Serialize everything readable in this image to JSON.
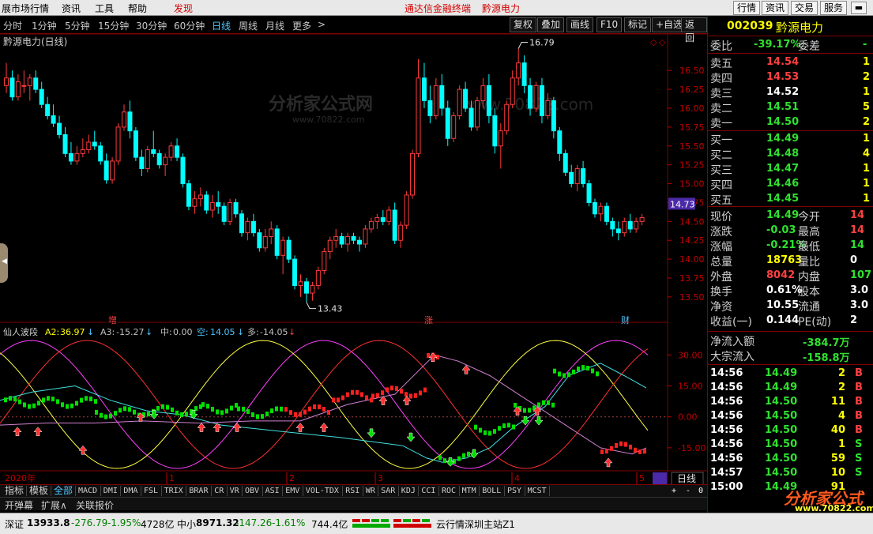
{
  "menu": {
    "items": [
      "展市场行情",
      "资讯",
      "工具",
      "帮助"
    ],
    "discover": "发现",
    "center_title": "通达信金融终端",
    "center_stock": "黔源电力",
    "right_buttons": [
      "行情",
      "资讯",
      "交易",
      "服务"
    ]
  },
  "periods": {
    "items": [
      "分时",
      "1分钟",
      "5分钟",
      "15分钟",
      "30分钟",
      "60分钟",
      "日线",
      "周线",
      "月线",
      "更多"
    ],
    "active": "日线",
    "more_arrow": ">",
    "tools": [
      "复权",
      "叠加",
      "画线",
      "F10",
      "标记",
      "+自选",
      "返回"
    ]
  },
  "main_chart": {
    "title": "黔源电力(日线)",
    "high_label": "16.79",
    "low_label": "13.43",
    "price_ticks": [
      "16.50",
      "16.25",
      "16.00",
      "15.75",
      "15.50",
      "15.25",
      "15.00",
      "14.75",
      "14.50",
      "14.25",
      "14.00",
      "13.75",
      "13.50"
    ],
    "current_price_tag": "14.73",
    "event_marks": [
      "增",
      "涨",
      "财"
    ],
    "watermark_1": "分析家公式网",
    "watermark_2": "www.70822.com",
    "watermark_3": "www.70822.com"
  },
  "indicator": {
    "name": "仙人波段",
    "a2_label": "A2:",
    "a2_value": "36.97",
    "a3_label": "A3:",
    "a3_value": "-15.27",
    "mid_label": "中:",
    "mid_value": "0.00",
    "empty_label": "空:",
    "empty_value": "14.05",
    "many_label": "多:",
    "many_value": "-14.05",
    "ticks": [
      "30.00",
      "15.00",
      "0.00",
      "-15.00"
    ]
  },
  "time_axis": {
    "labels": [
      "2020年",
      "1",
      "2",
      "3",
      "4",
      "5"
    ],
    "period_button": "日线"
  },
  "indicator_tabs": {
    "items": [
      "指标",
      "模板",
      "全部",
      "MACD",
      "DMI",
      "DMA",
      "FSL",
      "TRIX",
      "BRAR",
      "CR",
      "VR",
      "OBV",
      "ASI",
      "EMV",
      "VOL-TDX",
      "RSI",
      "WR",
      "SAR",
      "KDJ",
      "CCI",
      "ROC",
      "MTM",
      "BOLL",
      "PSY",
      "MCST"
    ],
    "active": "全部",
    "controls": [
      "+",
      "-",
      "0"
    ]
  },
  "bottom_links": [
    "开弹幕",
    "扩展∧",
    "关联报价"
  ],
  "quote": {
    "code": "002039",
    "name": "黔源电力",
    "weibi_label": "委比",
    "weibi": "-39.17%",
    "weicha_label": "委差",
    "weicha": "-",
    "asks": [
      {
        "label": "卖五",
        "price": "14.54",
        "vol": "1"
      },
      {
        "label": "卖四",
        "price": "14.53",
        "vol": "2"
      },
      {
        "label": "卖三",
        "price": "14.52",
        "vol": "1"
      },
      {
        "label": "卖二",
        "price": "14.51",
        "vol": "5"
      },
      {
        "label": "卖一",
        "price": "14.50",
        "vol": "2"
      }
    ],
    "bids": [
      {
        "label": "买一",
        "price": "14.49",
        "vol": "1"
      },
      {
        "label": "买二",
        "price": "14.48",
        "vol": "4"
      },
      {
        "label": "买三",
        "price": "14.47",
        "vol": "1"
      },
      {
        "label": "买四",
        "price": "14.46",
        "vol": "1"
      },
      {
        "label": "买五",
        "price": "14.45",
        "vol": "1"
      }
    ],
    "stats": [
      {
        "l1": "现价",
        "v1": "14.49",
        "c1": "dn",
        "l2": "今开",
        "v2": "14",
        "c2": "up"
      },
      {
        "l1": "涨跌",
        "v1": "-0.03",
        "c1": "dn",
        "l2": "最高",
        "v2": "14",
        "c2": "up"
      },
      {
        "l1": "涨幅",
        "v1": "-0.21%",
        "c1": "dn",
        "l2": "最低",
        "v2": "14",
        "c2": "dn"
      },
      {
        "l1": "总量",
        "v1": "18763",
        "c1": "yl",
        "l2": "量比",
        "v2": "0",
        "c2": "wt"
      },
      {
        "l1": "外盘",
        "v1": "8042",
        "c1": "up",
        "l2": "内盘",
        "v2": "107",
        "c2": "dn"
      },
      {
        "l1": "换手",
        "v1": "0.61%",
        "c1": "wt",
        "l2": "股本",
        "v2": "3.0",
        "c2": "wt"
      },
      {
        "l1": "净资",
        "v1": "10.55",
        "c1": "wt",
        "l2": "流通",
        "v2": "3.0",
        "c2": "wt"
      },
      {
        "l1": "收益(一)",
        "v1": "0.144",
        "c1": "wt",
        "l2": "PE(动)",
        "v2": "2",
        "c2": "wt"
      }
    ],
    "netflow_label": "净流入额",
    "netflow": "-384.7万",
    "bigflow_label": "大宗流入",
    "bigflow": "-158.8万",
    "ticks": [
      {
        "t": "14:56",
        "p": "14.49",
        "pc": "dn",
        "v": "2",
        "s": "B"
      },
      {
        "t": "14:56",
        "p": "14.49",
        "pc": "dn",
        "v": "2",
        "s": "B"
      },
      {
        "t": "14:56",
        "p": "14.50",
        "pc": "dn",
        "v": "11",
        "s": "B"
      },
      {
        "t": "14:56",
        "p": "14.50",
        "pc": "dn",
        "v": "4",
        "s": "B"
      },
      {
        "t": "14:56",
        "p": "14.50",
        "pc": "dn",
        "v": "40",
        "s": "B"
      },
      {
        "t": "14:56",
        "p": "14.50",
        "pc": "dn",
        "v": "1",
        "s": "S"
      },
      {
        "t": "14:56",
        "p": "14.50",
        "pc": "dn",
        "v": "59",
        "s": "S"
      },
      {
        "t": "14:57",
        "p": "14.50",
        "pc": "dn",
        "v": "10",
        "s": "S"
      },
      {
        "t": "15:00",
        "p": "14.49",
        "pc": "dn",
        "v": "91",
        "s": ""
      }
    ],
    "watermark_1": "分析家公式网",
    "watermark_2": "www.70822.com"
  },
  "status": {
    "sz_label": "深证",
    "sz_value": "13933.8",
    "sz_change": "-276.79",
    "sz_pct": "-1.95%",
    "sz_amount": "4728亿",
    "zx_label": "中小",
    "zx_value": "8971.32",
    "zx_change": "-147.26",
    "zx_pct": "-1.61%",
    "zx_amount": "744.4亿",
    "server": "云行情深圳主站Z1"
  },
  "colors": {
    "up": "#ff3b3b",
    "down": "#00ffff",
    "wave_red": "#ff2020",
    "wave_green": "#00e000",
    "grid_red": "#800000"
  },
  "chart_data": {
    "type": "candlestick",
    "ylim": [
      13.3,
      16.9
    ],
    "candles": [
      [
        16.3,
        16.6,
        16.2,
        16.4
      ],
      [
        16.4,
        16.5,
        16.1,
        16.15
      ],
      [
        16.15,
        16.45,
        16.1,
        16.35
      ],
      [
        16.3,
        16.5,
        16.2,
        16.3
      ],
      [
        16.3,
        16.45,
        16.1,
        16.4
      ],
      [
        16.4,
        16.5,
        16.2,
        16.25
      ],
      [
        16.25,
        16.35,
        16.0,
        16.05
      ],
      [
        16.05,
        16.15,
        15.85,
        15.9
      ],
      [
        15.9,
        16.05,
        15.75,
        15.8
      ],
      [
        15.8,
        15.9,
        15.6,
        15.65
      ],
      [
        15.65,
        15.75,
        15.35,
        15.4
      ],
      [
        15.4,
        15.55,
        15.25,
        15.3
      ],
      [
        15.3,
        15.5,
        15.25,
        15.4
      ],
      [
        15.4,
        15.6,
        15.35,
        15.45
      ],
      [
        15.45,
        15.65,
        15.4,
        15.55
      ],
      [
        15.55,
        15.7,
        15.45,
        15.5
      ],
      [
        15.5,
        15.55,
        15.25,
        15.3
      ],
      [
        15.3,
        15.4,
        15.0,
        15.05
      ],
      [
        15.05,
        15.35,
        15.0,
        15.3
      ],
      [
        15.3,
        15.8,
        15.25,
        15.75
      ],
      [
        15.75,
        16.05,
        15.7,
        15.95
      ],
      [
        15.95,
        16.1,
        15.6,
        15.7
      ],
      [
        15.7,
        15.75,
        15.3,
        15.35
      ],
      [
        15.35,
        15.45,
        15.1,
        15.2
      ],
      [
        15.2,
        15.5,
        15.15,
        15.45
      ],
      [
        15.45,
        15.7,
        15.35,
        15.4
      ],
      [
        15.4,
        15.45,
        15.2,
        15.25
      ],
      [
        15.25,
        15.4,
        15.1,
        15.35
      ],
      [
        15.35,
        15.55,
        15.3,
        15.5
      ],
      [
        15.5,
        15.6,
        15.3,
        15.35
      ],
      [
        15.35,
        15.4,
        14.95,
        15.0
      ],
      [
        15.0,
        15.05,
        14.65,
        14.7
      ],
      [
        14.7,
        14.9,
        14.6,
        14.8
      ],
      [
        14.8,
        14.95,
        14.7,
        14.85
      ],
      [
        14.85,
        14.9,
        14.6,
        14.65
      ],
      [
        14.65,
        14.85,
        14.55,
        14.75
      ],
      [
        14.75,
        14.9,
        14.6,
        14.7
      ],
      [
        14.7,
        14.75,
        14.45,
        14.5
      ],
      [
        14.5,
        14.8,
        14.45,
        14.75
      ],
      [
        14.75,
        14.8,
        14.55,
        14.6
      ],
      [
        14.6,
        14.65,
        14.3,
        14.35
      ],
      [
        14.35,
        14.55,
        14.25,
        14.5
      ],
      [
        14.5,
        14.6,
        14.3,
        14.35
      ],
      [
        14.35,
        14.4,
        14.1,
        14.15
      ],
      [
        14.15,
        14.4,
        14.1,
        14.3
      ],
      [
        14.3,
        14.5,
        14.2,
        14.4
      ],
      [
        14.4,
        14.45,
        14.0,
        14.05
      ],
      [
        14.05,
        14.3,
        13.8,
        14.25
      ],
      [
        14.25,
        14.3,
        13.95,
        14.0
      ],
      [
        14.0,
        14.05,
        13.6,
        13.65
      ],
      [
        13.65,
        13.8,
        13.5,
        13.7
      ],
      [
        13.7,
        13.75,
        13.43,
        13.55
      ],
      [
        13.55,
        13.7,
        13.45,
        13.65
      ],
      [
        13.65,
        13.9,
        13.6,
        13.85
      ],
      [
        13.85,
        14.15,
        13.8,
        14.1
      ],
      [
        14.1,
        14.3,
        14.0,
        14.25
      ],
      [
        14.25,
        14.4,
        14.15,
        14.3
      ],
      [
        14.3,
        14.35,
        14.15,
        14.2
      ],
      [
        14.2,
        14.35,
        14.1,
        14.3
      ],
      [
        14.3,
        14.35,
        14.2,
        14.25
      ],
      [
        14.25,
        14.3,
        14.1,
        14.2
      ],
      [
        14.2,
        14.45,
        14.15,
        14.4
      ],
      [
        14.4,
        14.55,
        14.35,
        14.5
      ],
      [
        14.5,
        14.6,
        14.4,
        14.55
      ],
      [
        14.55,
        14.65,
        14.45,
        14.5
      ],
      [
        14.5,
        14.7,
        14.45,
        14.65
      ],
      [
        14.65,
        14.75,
        14.2,
        14.25
      ],
      [
        14.25,
        14.5,
        14.15,
        14.45
      ],
      [
        14.45,
        14.9,
        14.4,
        14.85
      ],
      [
        14.85,
        15.45,
        14.8,
        15.4
      ],
      [
        15.4,
        16.65,
        15.35,
        16.4
      ],
      [
        16.4,
        16.6,
        16.0,
        16.1
      ],
      [
        16.1,
        16.3,
        15.8,
        15.9
      ],
      [
        15.9,
        16.4,
        15.85,
        16.3
      ],
      [
        16.3,
        16.45,
        15.9,
        16.0
      ],
      [
        16.0,
        16.1,
        15.5,
        15.6
      ],
      [
        15.6,
        15.95,
        15.55,
        15.9
      ],
      [
        15.9,
        16.3,
        15.85,
        16.25
      ],
      [
        16.25,
        16.35,
        15.95,
        16.0
      ],
      [
        16.0,
        16.1,
        15.7,
        15.75
      ],
      [
        15.75,
        16.15,
        15.7,
        16.1
      ],
      [
        16.1,
        16.4,
        16.0,
        16.3
      ],
      [
        16.3,
        16.45,
        15.8,
        15.9
      ],
      [
        15.9,
        16.0,
        15.4,
        15.5
      ],
      [
        15.5,
        15.8,
        15.2,
        15.7
      ],
      [
        15.7,
        16.1,
        15.65,
        16.05
      ],
      [
        16.05,
        16.5,
        16.0,
        16.4
      ],
      [
        16.4,
        16.79,
        16.3,
        16.6
      ],
      [
        16.6,
        16.7,
        16.2,
        16.3
      ],
      [
        16.3,
        16.4,
        15.9,
        16.0
      ],
      [
        16.0,
        16.35,
        15.95,
        16.3
      ],
      [
        16.3,
        16.4,
        15.8,
        15.9
      ],
      [
        15.9,
        16.2,
        15.85,
        16.1
      ],
      [
        16.1,
        16.15,
        15.6,
        15.7
      ],
      [
        15.7,
        15.75,
        15.3,
        15.4
      ],
      [
        15.4,
        15.45,
        15.1,
        15.15
      ],
      [
        15.15,
        15.25,
        14.95,
        15.0
      ],
      [
        15.0,
        15.25,
        14.9,
        15.2
      ],
      [
        15.2,
        15.3,
        14.95,
        15.0
      ],
      [
        15.0,
        15.05,
        14.7,
        14.75
      ],
      [
        14.75,
        14.8,
        14.55,
        14.6
      ],
      [
        14.6,
        14.75,
        14.5,
        14.7
      ],
      [
        14.7,
        14.75,
        14.45,
        14.5
      ],
      [
        14.5,
        14.55,
        14.3,
        14.4
      ],
      [
        14.4,
        14.5,
        14.25,
        14.35
      ],
      [
        14.35,
        14.55,
        14.3,
        14.5
      ],
      [
        14.5,
        14.6,
        14.35,
        14.4
      ],
      [
        14.4,
        14.55,
        14.35,
        14.5
      ],
      [
        14.5,
        14.6,
        14.45,
        14.55
      ]
    ],
    "indicator_ylim": [
      -25,
      42
    ]
  }
}
